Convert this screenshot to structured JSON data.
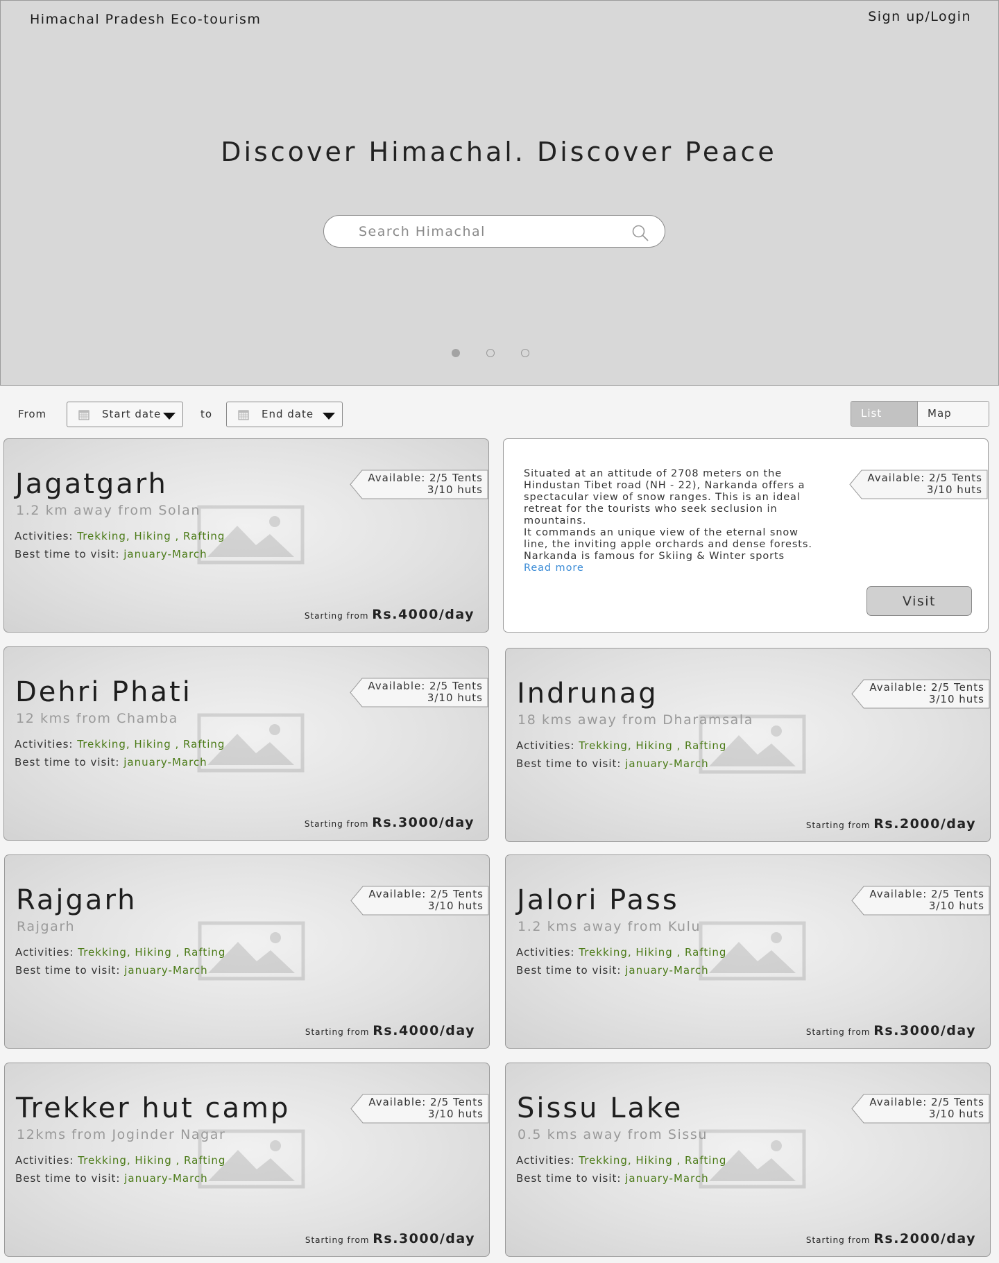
{
  "header": {
    "brand": "Himachal Pradesh Eco-tourism",
    "auth_link": "Sign up/Login",
    "tagline": "Discover Himachal. Discover Peace",
    "search_placeholder": "Search Himachal"
  },
  "carousel": {
    "slide_count": 3,
    "active_index": 0
  },
  "filters": {
    "from_label": "From",
    "start_date": "Start date",
    "to_label": "to",
    "end_date": "End date",
    "list_view": "List view",
    "map_view": "Map view",
    "active_view": "List view"
  },
  "labels": {
    "activities": "Activities: ",
    "best_time": "Best time to visit: ",
    "starting_from": "Starting from "
  },
  "featured": {
    "availability_tents": "Available: 2/5 Tents",
    "availability_huts": "3/10 huts",
    "description": "Situated at an attitude of 2708 meters on the Hindustan Tibet road (NH - 22), Narkanda offers a spectacular view of snow ranges. This is an ideal retreat for the tourists who seek seclusion in mountains.",
    "description_2": "It commands an unique view of the eternal snow line, the inviting apple orchards and dense forests. Narkanda is famous for Skiing & Winter sports",
    "read_more": "Read more",
    "visit_label": "Visit"
  },
  "destinations": [
    {
      "name": "Jagatgarh",
      "distance": "1.2 km away from Solan",
      "activities": "Trekking, Hiking , Rafting",
      "best_time": "january-March",
      "price": "Rs.4000/day",
      "availability_tents": "Available: 2/5 Tents",
      "availability_huts": "3/10 huts"
    },
    {
      "name": "Dehri Phati",
      "distance": "12 kms from Chamba",
      "activities": "Trekking, Hiking , Rafting",
      "best_time": "january-March",
      "price": "Rs.3000/day",
      "availability_tents": "Available: 2/5 Tents",
      "availability_huts": "3/10 huts"
    },
    {
      "name": "Indrunag",
      "distance": "18 kms away from Dharamsala",
      "activities": "Trekking, Hiking , Rafting",
      "best_time": "january-March",
      "price": "Rs.2000/day",
      "availability_tents": "Available: 2/5 Tents",
      "availability_huts": "3/10 huts"
    },
    {
      "name": "Rajgarh",
      "distance": "Rajgarh",
      "activities": "Trekking, Hiking , Rafting",
      "best_time": "january-March",
      "price": "Rs.4000/day",
      "availability_tents": "Available: 2/5 Tents",
      "availability_huts": "3/10 huts"
    },
    {
      "name": "Jalori Pass",
      "distance": "1.2 kms away from Kulu",
      "activities": "Trekking, Hiking , Rafting",
      "best_time": "january-March",
      "price": "Rs.3000/day",
      "availability_tents": "Available: 2/5 Tents",
      "availability_huts": "3/10 huts"
    },
    {
      "name": "Trekker hut camp",
      "distance": "12kms from Joginder Nagar",
      "activities": "Trekking, Hiking , Rafting",
      "best_time": "january-March",
      "price": "Rs.3000/day",
      "availability_tents": "Available: 2/5 Tents",
      "availability_huts": "3/10 huts"
    },
    {
      "name": "Sissu Lake",
      "distance": "0.5 kms away from Sissu",
      "activities": "Trekking, Hiking , Rafting",
      "best_time": "january-March",
      "price": "Rs.2000/day",
      "availability_tents": "Available: 2/5 Tents",
      "availability_huts": "3/10 huts"
    }
  ],
  "icons": {
    "search": "search-icon",
    "calendar": "calendar-icon",
    "dropdown": "chevron-down-icon",
    "image_placeholder": "image-placeholder-icon",
    "tag": "tag-icon"
  },
  "colors": {
    "hero_bg": "#d8d8d8",
    "accent_green": "#4a7a16",
    "link_blue": "#3a8bd6",
    "active_toggle": "#c2c2c2"
  }
}
